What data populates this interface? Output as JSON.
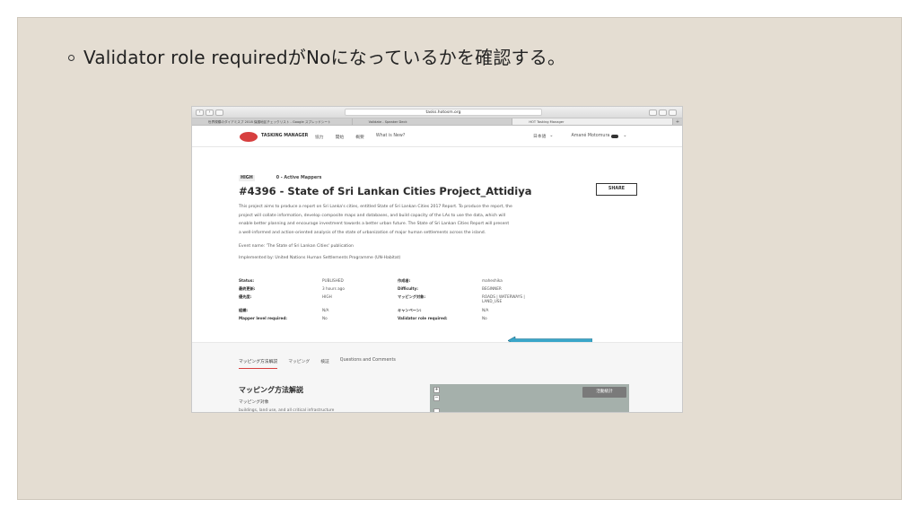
{
  "slide": {
    "bullet": "Validator role requiredがNoになっているかを確認する。"
  },
  "browser": {
    "url": "tasks.hotosm.org",
    "tabs": [
      "世界規模のダイアミスプ 2018 保護地区チェックリスト - Google スプレッドシート",
      "Validate - Speaker Deck",
      "HOT Tasking Manager"
    ],
    "tab_plus": "+"
  },
  "header": {
    "logo_text": "TASKING MANAGER",
    "nav": [
      "協力",
      "開始",
      "概要",
      "What is New?"
    ],
    "language": "日本語",
    "user": "Amané Motomura"
  },
  "project": {
    "priority": "HIGH",
    "mappers": "0 - Active Mappers",
    "title": "#4396 - State of Sri Lankan Cities Project_Attidiya",
    "description": "This project aims to produce a report on Sri Lanka's cities, entitled State of Sri Lankan Cities 2017 Report. To produce the report, the project will collate information, develop composite maps and databases, and build capacity of the LAs to use the data, which will enable better planning and encourage investment towards a better urban future. The State of Sri Lankan Cities Report will present a well-informed and action-oriented analysis of the state of urbanization of major human settlements across the island.",
    "event": "Event name: 'The State of Sri Lankan Cities' publication",
    "implemented": "Implemented by: United Nations Human Settlements Programme (UN-Habitat)",
    "share": "SHARE"
  },
  "meta": {
    "rows": [
      {
        "l1": "Status:",
        "v1": "PUBLISHED",
        "l2": "作成者:",
        "v2": "maheshika"
      },
      {
        "l1": "最終更新:",
        "v1": "3 hours ago",
        "l2": "Difficulty:",
        "v2": "BEGINNER"
      },
      {
        "l1": "優先度:",
        "v1": "HIGH",
        "l2": "マッピング対象:",
        "v2": "ROADS | WATERWAYS | LAND_USE"
      },
      {
        "l1": "組織:",
        "v1": "N/A",
        "l2": "キャンペーン:",
        "v2": "N/A"
      },
      {
        "l1": "Mapper level required:",
        "v1": "No",
        "l2": "Validator role required:",
        "v2": "No"
      }
    ]
  },
  "lower": {
    "tabs": [
      "マッピング方法解説",
      "マッピング",
      "検証",
      "Questions and Comments"
    ],
    "section_title": "マッピング方法解説",
    "subsection": "マッピング対象",
    "subsection_value": "buildings, land use, and all critical infrastructure",
    "stats_button": "活動統計"
  },
  "colors": {
    "slide_bg": "#e4ddd2",
    "accent": "#d73f3f",
    "arrow": "#3aa6c9"
  }
}
